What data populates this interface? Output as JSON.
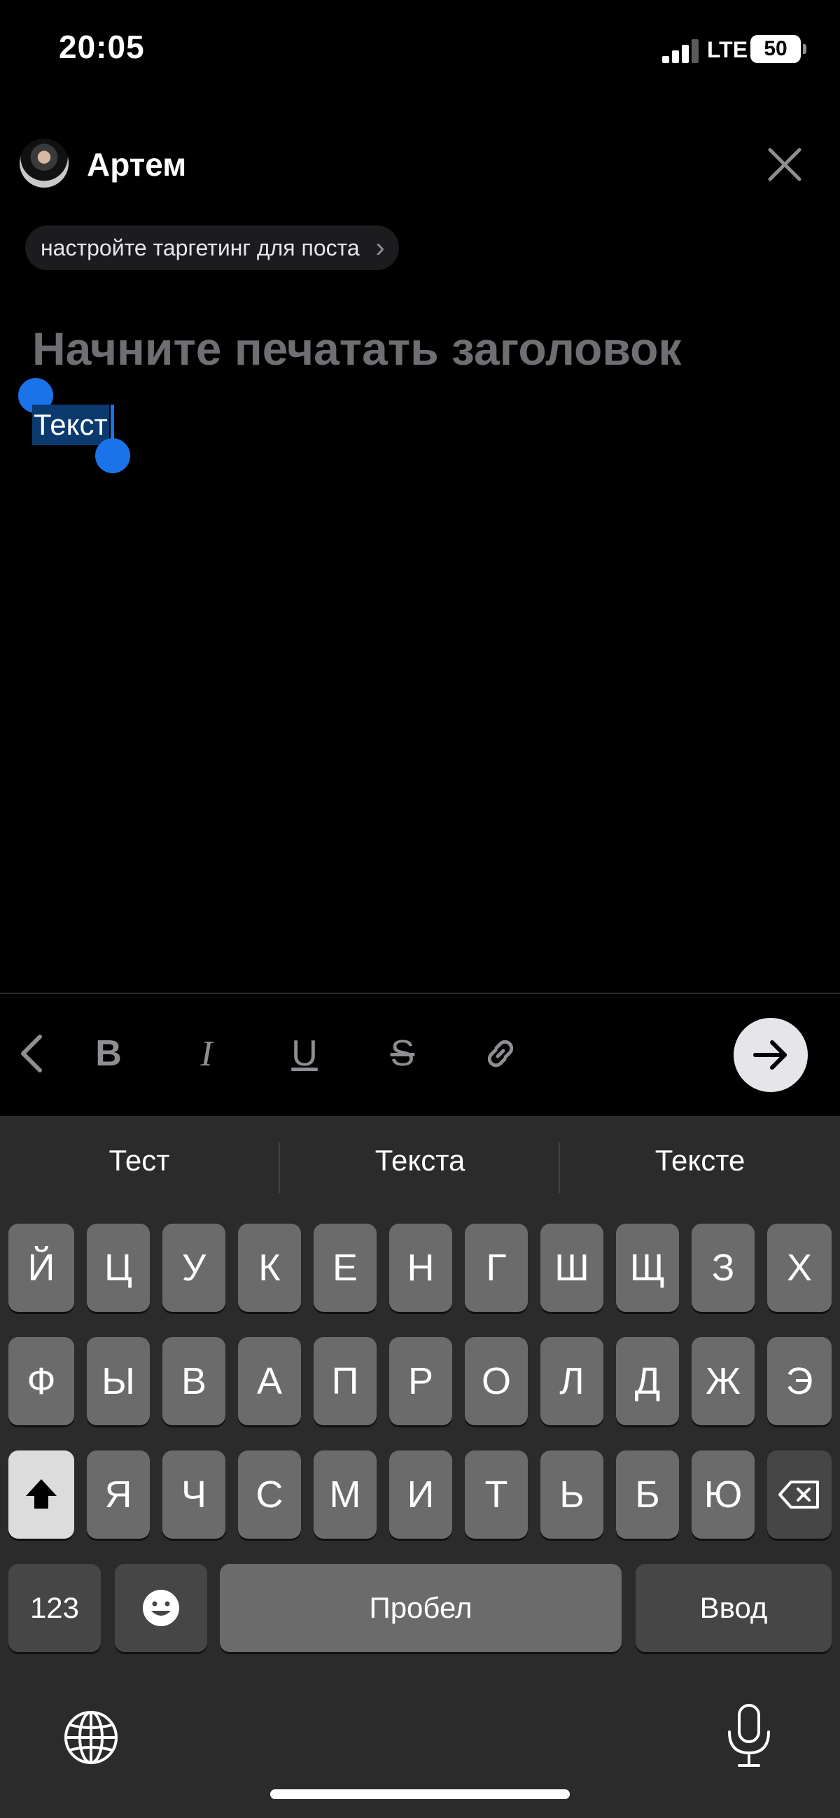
{
  "status_bar": {
    "time": "20:05",
    "network": "LTE",
    "battery": "50"
  },
  "header": {
    "author_name": "Артем"
  },
  "targeting_chip": {
    "label": "настройте таргетинг для поста",
    "chevron": "›"
  },
  "editor": {
    "title_placeholder": "Начните печатать заголовок",
    "body_text": "Текст"
  },
  "toolbar": {
    "back": "‹",
    "bold": "B",
    "italic": "I",
    "underline": "U",
    "strike": "S"
  },
  "keyboard": {
    "suggestions": [
      "Тест",
      "Текста",
      "Тексте"
    ],
    "row1": [
      "Й",
      "Ц",
      "У",
      "К",
      "Е",
      "Н",
      "Г",
      "Ш",
      "Щ",
      "З",
      "Х"
    ],
    "row2": [
      "Ф",
      "Ы",
      "В",
      "А",
      "П",
      "Р",
      "О",
      "Л",
      "Д",
      "Ж",
      "Э"
    ],
    "row3": [
      "Я",
      "Ч",
      "С",
      "М",
      "И",
      "Т",
      "Ь",
      "Б",
      "Ю"
    ],
    "numbers_label": "123",
    "space_label": "Пробел",
    "return_label": "Ввод"
  },
  "icons": {
    "close": "close-icon",
    "link": "link-icon",
    "send": "arrow-right-icon",
    "shift": "shift-icon",
    "backspace": "backspace-icon",
    "emoji": "emoji-icon",
    "globe": "globe-icon",
    "mic": "microphone-icon"
  },
  "colors": {
    "selection_handle": "#1a73e8",
    "selection_bg": "#0b3a6e",
    "background": "#000000",
    "keyboard_bg": "#2b2b2b"
  }
}
